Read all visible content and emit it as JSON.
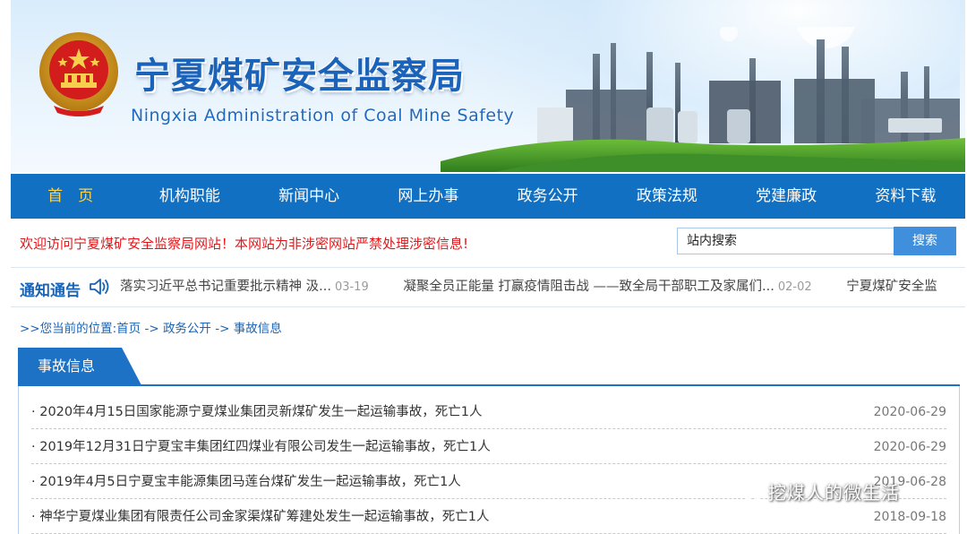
{
  "header": {
    "title_cn": "宁夏煤矿安全监察局",
    "title_en": "Ningxia Administration of Coal Mine Safety"
  },
  "nav": {
    "items": [
      {
        "label": "首　页",
        "active": true
      },
      {
        "label": "机构职能",
        "active": false
      },
      {
        "label": "新闻中心",
        "active": false
      },
      {
        "label": "网上办事",
        "active": false
      },
      {
        "label": "政务公开",
        "active": false
      },
      {
        "label": "政策法规",
        "active": false
      },
      {
        "label": "党建廉政",
        "active": false
      },
      {
        "label": "资料下载",
        "active": false
      }
    ]
  },
  "welcome": "欢迎访问宁夏煤矿安全监察局网站！本网站为非涉密网站严禁处理涉密信息!",
  "search": {
    "value": "站内搜索",
    "button": "搜索"
  },
  "notice": {
    "title": "通知通告",
    "items": [
      {
        "text": "落实习近平总书记重要批示精神 汲...",
        "date": "03-19"
      },
      {
        "text": "凝聚全员正能量 打赢疫情阻击战 ——致全局干部职工及家属们...",
        "date": "02-02"
      },
      {
        "text": "宁夏煤矿安全监",
        "date": ""
      }
    ]
  },
  "breadcrumb": {
    "prefix": ">>您当前的位置:",
    "home": "首页",
    "sep1": " -> ",
    "level1": "政务公开",
    "sep2": " -> ",
    "level2": "事故信息"
  },
  "section": {
    "title": "事故信息",
    "rows": [
      {
        "title": "· 2020年4月15日国家能源宁夏煤业集团灵新煤矿发生一起运输事故，死亡1人",
        "date": "2020-06-29"
      },
      {
        "title": "· 2019年12月31日宁夏宝丰集团红四煤业有限公司发生一起运输事故，死亡1人",
        "date": "2020-06-29"
      },
      {
        "title": "· 2019年4月5日宁夏宝丰能源集团马莲台煤矿发生一起运输事故，死亡1人",
        "date": "2019-06-28"
      },
      {
        "title": "· 神华宁夏煤业集团有限责任公司金家渠煤矿筹建处发生一起运输事故，死亡1人",
        "date": "2018-09-18"
      }
    ]
  },
  "watermark": "挖煤人的微生活",
  "colors": {
    "nav_bg": "#1270c3",
    "nav_active": "#ffd24a",
    "alert_red": "#e0181b",
    "link_blue": "#1b64b4"
  }
}
